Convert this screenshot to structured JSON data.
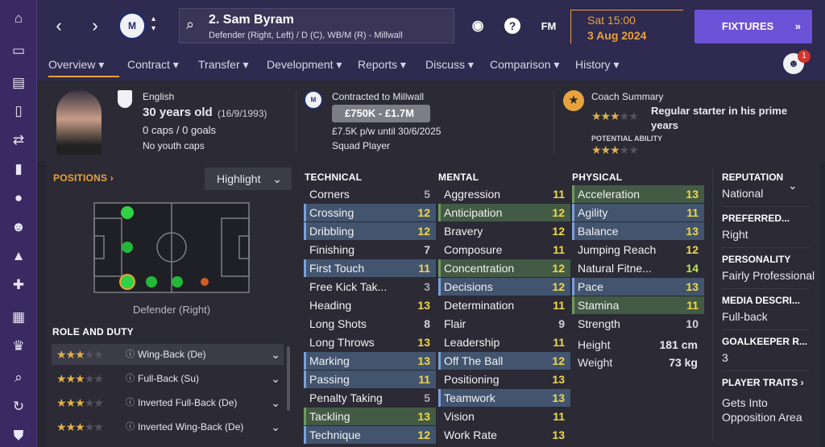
{
  "sidebar": {
    "icons": [
      "home-icon",
      "inbox-icon",
      "squad-icon",
      "clipboard-icon",
      "transfers-icon",
      "training-icon",
      "globe-icon",
      "staff-icon",
      "tactics-icon",
      "medical-icon",
      "calendar-icon",
      "trophy-icon",
      "search-icon",
      "sync-icon",
      "shield-icon"
    ]
  },
  "header": {
    "player_name": "2. Sam Byram",
    "player_sub": "Defender (Right, Left) / D (C), WB/M (R) - Millwall",
    "day_time": "Sat 15:00",
    "date": "3 Aug 2024",
    "fixtures_label": "FIXTURES",
    "fm_label": "FM",
    "help_label": "?",
    "notification_count": "1"
  },
  "tabs": [
    {
      "label": "Overview",
      "active": true
    },
    {
      "label": "Contract"
    },
    {
      "label": "Transfer"
    },
    {
      "label": "Development"
    },
    {
      "label": "Reports"
    },
    {
      "label": "Discuss"
    },
    {
      "label": "Comparison"
    },
    {
      "label": "History"
    }
  ],
  "profile": {
    "nationality": "English",
    "age": "30 years old",
    "dob": "(16/9/1993)",
    "caps": "0 caps / 0 goals",
    "youth": "No youth caps"
  },
  "contract": {
    "title": "Contracted to Millwall",
    "value": "£750K - £1.7M",
    "wage": "£7.5K p/w until 30/6/2025",
    "status": "Squad Player"
  },
  "coach": {
    "title": "Coach Summary",
    "summary": "Regular starter in his prime years",
    "current_stars": 3,
    "potential_label": "POTENTIAL ABILITY",
    "potential_stars": 3
  },
  "positions": {
    "title": "POSITIONS",
    "dropdown": "Highlight",
    "caption": "Defender (Right)"
  },
  "roles": {
    "title": "ROLE AND DUTY",
    "items": [
      {
        "name": "Wing-Back (De)",
        "stars": 3
      },
      {
        "name": "Full-Back (Su)",
        "stars": 3
      },
      {
        "name": "Inverted Full-Back (De)",
        "stars": 3
      },
      {
        "name": "Inverted Wing-Back (De)",
        "stars": 3
      }
    ]
  },
  "technical": {
    "title": "TECHNICAL",
    "items": [
      {
        "name": "Corners",
        "value": "5"
      },
      {
        "name": "Crossing",
        "value": "12"
      },
      {
        "name": "Dribbling",
        "value": "12"
      },
      {
        "name": "Finishing",
        "value": "7"
      },
      {
        "name": "First Touch",
        "value": "11"
      },
      {
        "name": "Free Kick Tak...",
        "value": "3"
      },
      {
        "name": "Heading",
        "value": "13"
      },
      {
        "name": "Long Shots",
        "value": "8"
      },
      {
        "name": "Long Throws",
        "value": "13"
      },
      {
        "name": "Marking",
        "value": "13"
      },
      {
        "name": "Passing",
        "value": "11"
      },
      {
        "name": "Penalty Taking",
        "value": "5"
      },
      {
        "name": "Tackling",
        "value": "13"
      },
      {
        "name": "Technique",
        "value": "12"
      }
    ]
  },
  "mental": {
    "title": "MENTAL",
    "items": [
      {
        "name": "Aggression",
        "value": "11"
      },
      {
        "name": "Anticipation",
        "value": "12"
      },
      {
        "name": "Bravery",
        "value": "12"
      },
      {
        "name": "Composure",
        "value": "11"
      },
      {
        "name": "Concentration",
        "value": "12"
      },
      {
        "name": "Decisions",
        "value": "12"
      },
      {
        "name": "Determination",
        "value": "11"
      },
      {
        "name": "Flair",
        "value": "9"
      },
      {
        "name": "Leadership",
        "value": "11"
      },
      {
        "name": "Off The Ball",
        "value": "12"
      },
      {
        "name": "Positioning",
        "value": "13"
      },
      {
        "name": "Teamwork",
        "value": "13"
      },
      {
        "name": "Vision",
        "value": "11"
      },
      {
        "name": "Work Rate",
        "value": "13"
      }
    ]
  },
  "physical": {
    "title": "PHYSICAL",
    "items": [
      {
        "name": "Acceleration",
        "value": "13"
      },
      {
        "name": "Agility",
        "value": "11"
      },
      {
        "name": "Balance",
        "value": "13"
      },
      {
        "name": "Jumping Reach",
        "value": "12"
      },
      {
        "name": "Natural Fitne...",
        "value": "14"
      },
      {
        "name": "Pace",
        "value": "13"
      },
      {
        "name": "Stamina",
        "value": "11"
      },
      {
        "name": "Strength",
        "value": "10"
      }
    ],
    "height_label": "Height",
    "height": "181 cm",
    "weight_label": "Weight",
    "weight": "73 kg"
  },
  "side": {
    "reputation_h": "REPUTATION",
    "reputation": "National",
    "foot_h": "PREFERRED...",
    "foot": "Right",
    "personality_h": "PERSONALITY",
    "personality": "Fairly Professional",
    "media_h": "MEDIA DESCRI...",
    "media": "Full-back",
    "gk_h": "GOALKEEPER R...",
    "gk": "3",
    "traits_h": "PLAYER TRAITS",
    "traits": "Gets Into Opposition Area"
  },
  "colors": {
    "accent": "#e8a33d",
    "purple": "#6b52d6",
    "highlight_blue": "#42546e",
    "highlight_green": "#435a44",
    "value_yellow": "#f0d84a",
    "value_green": "#c6e25a"
  }
}
